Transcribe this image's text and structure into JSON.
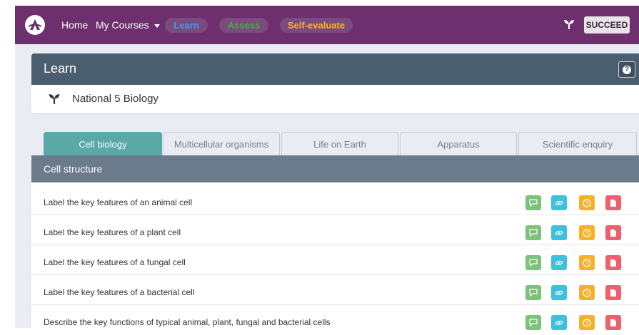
{
  "nav": {
    "home": "Home",
    "my_courses": "My Courses",
    "pills": [
      {
        "label": "Learn",
        "color": "#3d9cf0"
      },
      {
        "label": "Assess",
        "color": "#3fb33f"
      },
      {
        "label": "Self-evaluate",
        "color": "#ffb31a"
      }
    ],
    "succeed": "SUCCEED",
    "brand_color": "#6d2f6d"
  },
  "learn_panel": {
    "title": "Learn",
    "help_icon": "question-circle-icon",
    "course": "National 5 Biology",
    "course_icon": "sprout-icon"
  },
  "tabs": [
    {
      "label": "Cell biology",
      "active": true
    },
    {
      "label": "Multicellular organisms",
      "active": false
    },
    {
      "label": "Life on Earth",
      "active": false
    },
    {
      "label": "Apparatus",
      "active": false
    },
    {
      "label": "Scientific enquiry",
      "active": false
    }
  ],
  "section": {
    "title": "Cell structure",
    "rows": [
      {
        "label": "Label the key features of an animal cell"
      },
      {
        "label": "Label the key features of a plant cell"
      },
      {
        "label": "Label the key features of a fungal cell"
      },
      {
        "label": "Label the key features of a bacterial cell"
      },
      {
        "label": "Describe the key functions of typical animal, plant, fungal and bacterial cells"
      }
    ],
    "row_actions": [
      {
        "icon": "comment-icon",
        "color": "#7dc27a"
      },
      {
        "icon": "link-icon",
        "color": "#3fc0de"
      },
      {
        "icon": "question-icon",
        "color": "#f4b129"
      },
      {
        "icon": "document-icon",
        "color": "#ef5f6d"
      }
    ]
  }
}
